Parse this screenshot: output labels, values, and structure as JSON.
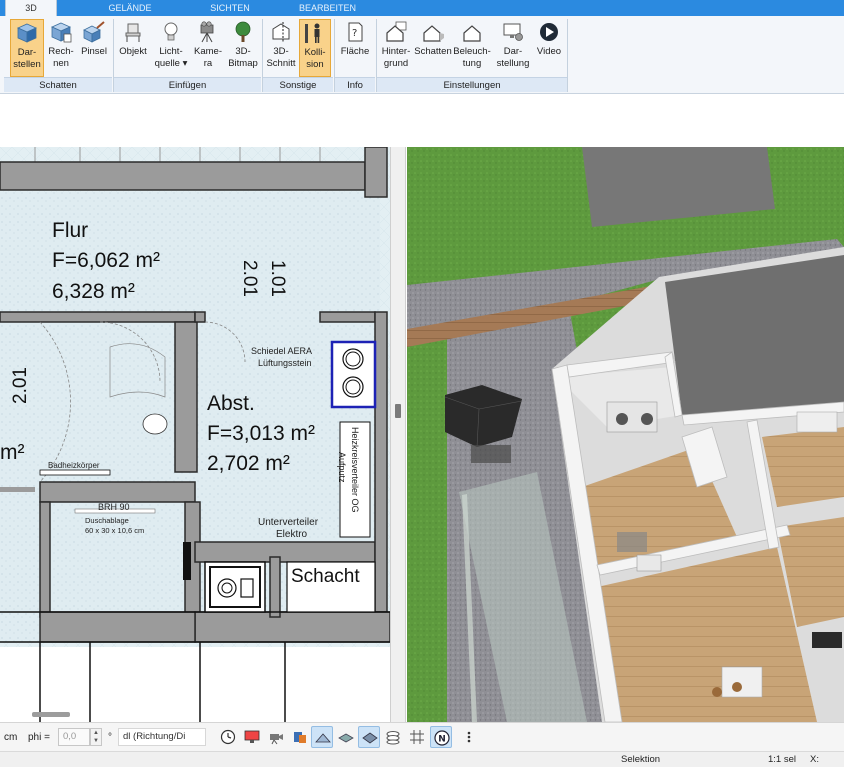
{
  "ribbon": {
    "tabs": [
      {
        "label": "3D",
        "active": true
      },
      {
        "label": "GELÄNDE"
      },
      {
        "label": "SICHTEN"
      },
      {
        "label": "BEARBEITEN"
      }
    ],
    "groups": [
      {
        "label": "Schatten",
        "buttons": [
          {
            "label": "Dar-\nstellen",
            "icon": "cube-shade-icon",
            "selected": true
          },
          {
            "label": "Rech-\nnen",
            "icon": "cube-calc-icon"
          },
          {
            "label": "Pinsel",
            "icon": "cube-brush-icon"
          }
        ]
      },
      {
        "label": "Einfügen",
        "buttons": [
          {
            "label": "Objekt",
            "icon": "chair-icon"
          },
          {
            "label": "Licht-\nquelle ▾",
            "icon": "lightbulb-icon"
          },
          {
            "label": "Kame-\nra",
            "icon": "camera-icon"
          },
          {
            "label": "3D-\nBitmap",
            "icon": "tree-icon"
          }
        ]
      },
      {
        "label": "Sonstige",
        "buttons": [
          {
            "label": "3D-\nSchnitt",
            "icon": "section-cut-icon"
          },
          {
            "label": "Kolli-\nsion",
            "icon": "person-collision-icon",
            "selected": true
          }
        ]
      },
      {
        "label": "Info",
        "buttons": [
          {
            "label": "Fläche",
            "icon": "area-info-icon"
          }
        ]
      },
      {
        "label": "Einstellungen",
        "buttons": [
          {
            "label": "Hinter-\ngrund",
            "icon": "house-background-icon"
          },
          {
            "label": "Schatten",
            "icon": "house-shadow-icon"
          },
          {
            "label": "Beleuch-\ntung",
            "icon": "house-lighting-icon"
          },
          {
            "label": "Dar-\nstellung",
            "icon": "monitor-settings-icon"
          },
          {
            "label": "Video",
            "icon": "play-video-icon"
          }
        ]
      }
    ]
  },
  "plan": {
    "rooms": [
      {
        "name": "Flur",
        "area1": "F=6,062 m²",
        "area2": "6,328 m²"
      },
      {
        "name": "Abst.",
        "area1": "F=3,013 m²",
        "area2": "2,702 m²"
      }
    ],
    "labels": {
      "dim_vertical": "1.01",
      "dim_vertical2": "2.01",
      "dim_left": "2.01",
      "m2_fragment": "m²",
      "vent": "Schiedel AERA",
      "vent2": "Lüftungsstein",
      "radiator": "Badheizkörper",
      "brh": "BRH 90",
      "shelf": "Duschablage",
      "shelf_dims": "60 x 30 x 10,6 cm",
      "heizkreis": "Heizkreisverteiler OG",
      "aufputz": "Aufputz",
      "unterverteiler": "Unterverteiler",
      "elektro": "Elektro",
      "schacht": "Schacht"
    }
  },
  "bottombar": {
    "unit": "cm",
    "phi_label": "phi =",
    "phi_value": "0,0",
    "degree": "°",
    "direction_combo": "dl (Richtung/Di",
    "tools": [
      "clock-icon",
      "monitor-icon",
      "camera-icon",
      "paint-icon",
      "plane-view-icon",
      "texture-icon",
      "layer-icon",
      "stack-icon",
      "grid-icon",
      "north-icon",
      "more-icon"
    ]
  },
  "status": {
    "mode": "Selektion",
    "selection": "1:1 sel",
    "x_label": "X:"
  },
  "colors": {
    "tab_blue": "#2b8ae0",
    "selected_button": "#f9d28a",
    "grass": "#5e9a3e",
    "floor_wood": "#c8a477"
  }
}
